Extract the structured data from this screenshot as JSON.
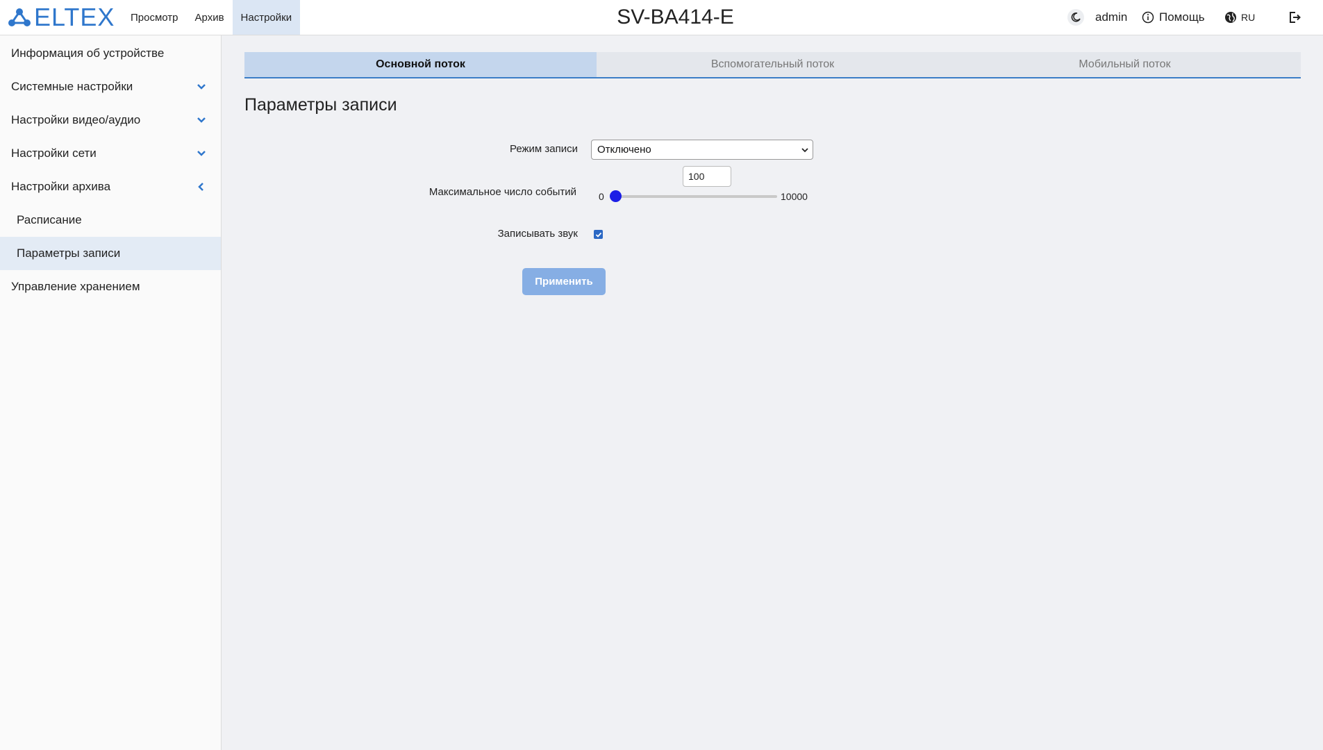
{
  "header": {
    "logo_text": "ELTEX",
    "nav": [
      {
        "label": "Просмотр"
      },
      {
        "label": "Архив"
      },
      {
        "label": "Настройки",
        "active": true
      }
    ],
    "device_title": "SV-BA414-E",
    "user": "admin",
    "help_label": "Помощь",
    "language": "RU"
  },
  "sidebar": {
    "items": [
      {
        "label": "Информация об устройстве"
      },
      {
        "label": "Системные настройки",
        "icon": "chevron-down-icon"
      },
      {
        "label": "Настройки видео/аудио",
        "icon": "chevron-down-icon"
      },
      {
        "label": "Настройки сети",
        "icon": "chevron-down-icon"
      },
      {
        "label": "Настройки архива",
        "icon": "chevron-left-icon"
      },
      {
        "label": "Расписание"
      },
      {
        "label": "Параметры записи",
        "active": true
      },
      {
        "label": "Управление хранением"
      }
    ]
  },
  "tabs": [
    {
      "label": "Основной поток",
      "active": true
    },
    {
      "label": "Вспомогательный поток"
    },
    {
      "label": "Мобильный поток"
    }
  ],
  "main": {
    "title": "Параметры записи",
    "record_mode_label": "Режим записи",
    "record_mode_value": "Отключено",
    "max_events_label": "Максимальное число событий",
    "max_events_value": "100",
    "slider_min": "0",
    "slider_max": "10000",
    "record_sound_label": "Записывать звук",
    "record_sound_checked": true,
    "apply_label": "Применить"
  },
  "colors": {
    "accent": "#2f77cc",
    "tab_active": "#c4d6ed",
    "slider_thumb": "#1b1ee6",
    "button": "#86aee4"
  }
}
